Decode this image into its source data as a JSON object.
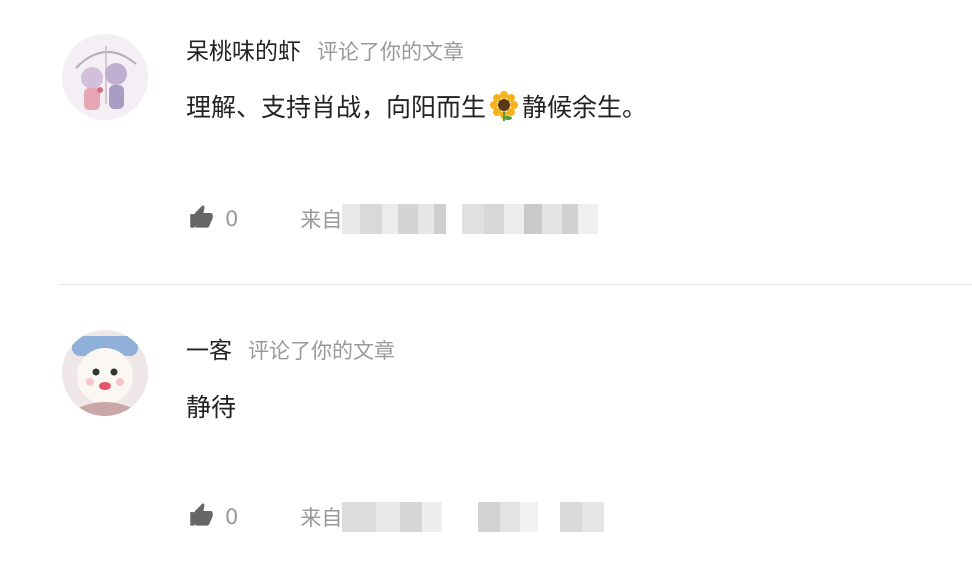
{
  "comments": [
    {
      "username": "呆桃味的虾",
      "action": "评论了你的文章",
      "text_before": "理解、支持肖战，向阳而生",
      "emoji_icon": "sunflower-icon",
      "text_after": "静候余生。",
      "like_count": "0",
      "source_label": "来自"
    },
    {
      "username": "一客",
      "action": "评论了你的文章",
      "text_before": "静待",
      "like_count": "0",
      "source_label": "来自"
    }
  ],
  "colors": {
    "secondary_text": "#999999",
    "primary_text": "#222222",
    "divider": "#e6e6e6"
  }
}
